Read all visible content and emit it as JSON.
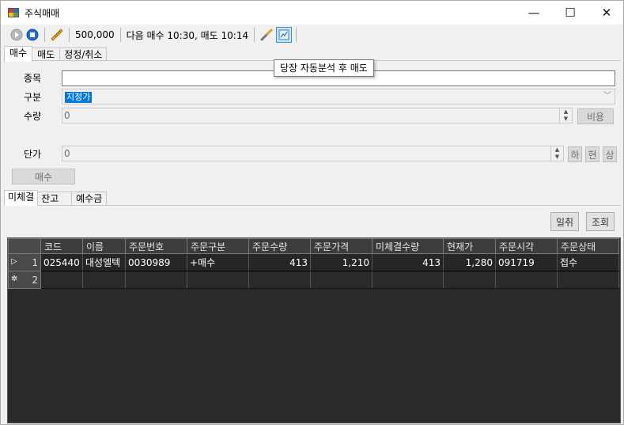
{
  "window": {
    "title": "주식매매",
    "minimize_glyph": "—",
    "maximize_glyph": "☐",
    "close_glyph": "✕"
  },
  "toolbar": {
    "amount": "500,000",
    "schedule": "다음 매수 10:30, 매도 10:14"
  },
  "tooltip": {
    "text": "당장 자동분석 후 매도"
  },
  "top_tabs": [
    {
      "label": "매수"
    },
    {
      "label": "매도"
    },
    {
      "label": "정정/취소"
    }
  ],
  "order_form": {
    "symbol_label": "종목",
    "symbol_value": "",
    "type_label": "구분",
    "type_value": "지정가",
    "qty_label": "수량",
    "qty_value": "0",
    "cost_button": "비용",
    "price_label": "단가",
    "price_value": "0",
    "low_button": "하",
    "current_button": "현",
    "high_button": "상",
    "buy_button": "매수"
  },
  "bottom_tabs": [
    {
      "label": "미체결"
    },
    {
      "label": "잔고"
    },
    {
      "label": "예수금"
    }
  ],
  "actions": {
    "cancel_all": "일취",
    "query": "조회"
  },
  "grid": {
    "columns": [
      "코드",
      "이름",
      "주문번호",
      "주문구분",
      "주문수량",
      "주문가격",
      "미체결수량",
      "현재가",
      "주문시각",
      "주문상태"
    ],
    "rows": [
      {
        "num": "1",
        "marker": "▷",
        "cells": [
          "025440",
          "대성엘텍",
          "0030989",
          "+매수",
          "413",
          "1,210",
          "413",
          "1,280",
          "091719",
          "접수"
        ]
      },
      {
        "num": "2",
        "marker": "✲",
        "cells": [
          "",
          "",
          "",
          "",
          "",
          "",
          "",
          "",
          "",
          ""
        ]
      }
    ]
  }
}
